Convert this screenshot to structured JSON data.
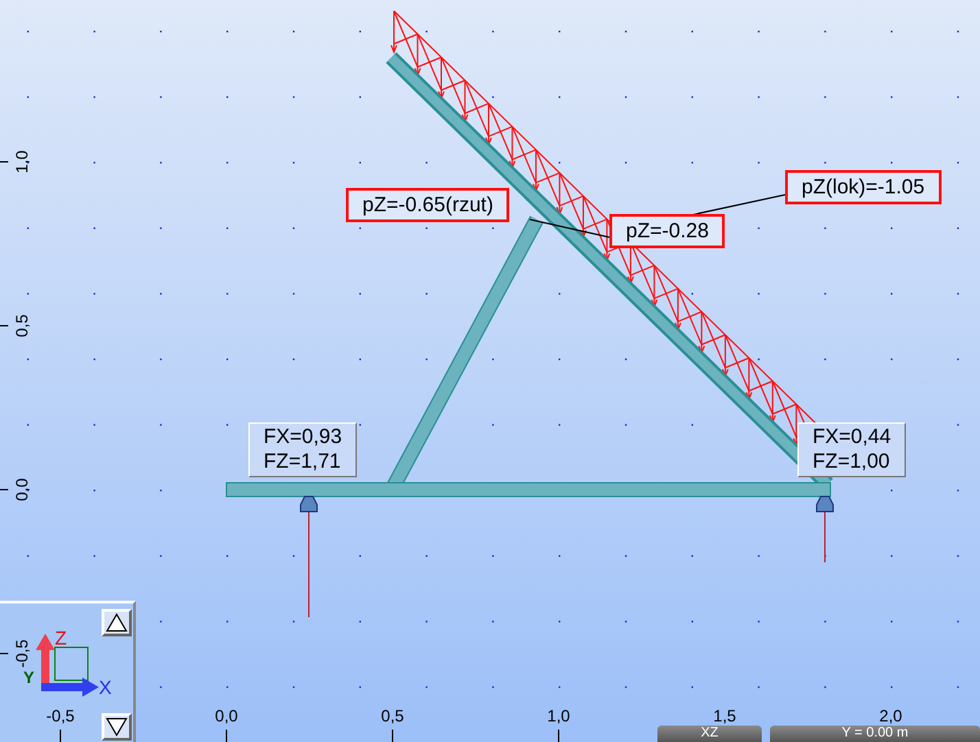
{
  "x_axis": {
    "labels": [
      "-0,5",
      "0,0",
      "0,5",
      "1,0",
      "1,5",
      "2,0"
    ]
  },
  "y_axis": {
    "labels": [
      "1,0",
      "0,5",
      "0,0",
      "-0,5"
    ]
  },
  "load_labels": [
    "pZ=-0.65(rzut)",
    "pZ=-0.28",
    "pZ(lok)=-1.05"
  ],
  "reactions": [
    {
      "lines": [
        "FX=0,93",
        "FZ=1,71"
      ]
    },
    {
      "lines": [
        "FX=0,44",
        "FZ=1,00"
      ]
    }
  ],
  "view_triad": {
    "z": "Z",
    "y": "Y",
    "x": "X"
  },
  "view_buttons": [
    {
      "label": "XZ"
    },
    {
      "label": "Y = 0.00 m"
    }
  ]
}
